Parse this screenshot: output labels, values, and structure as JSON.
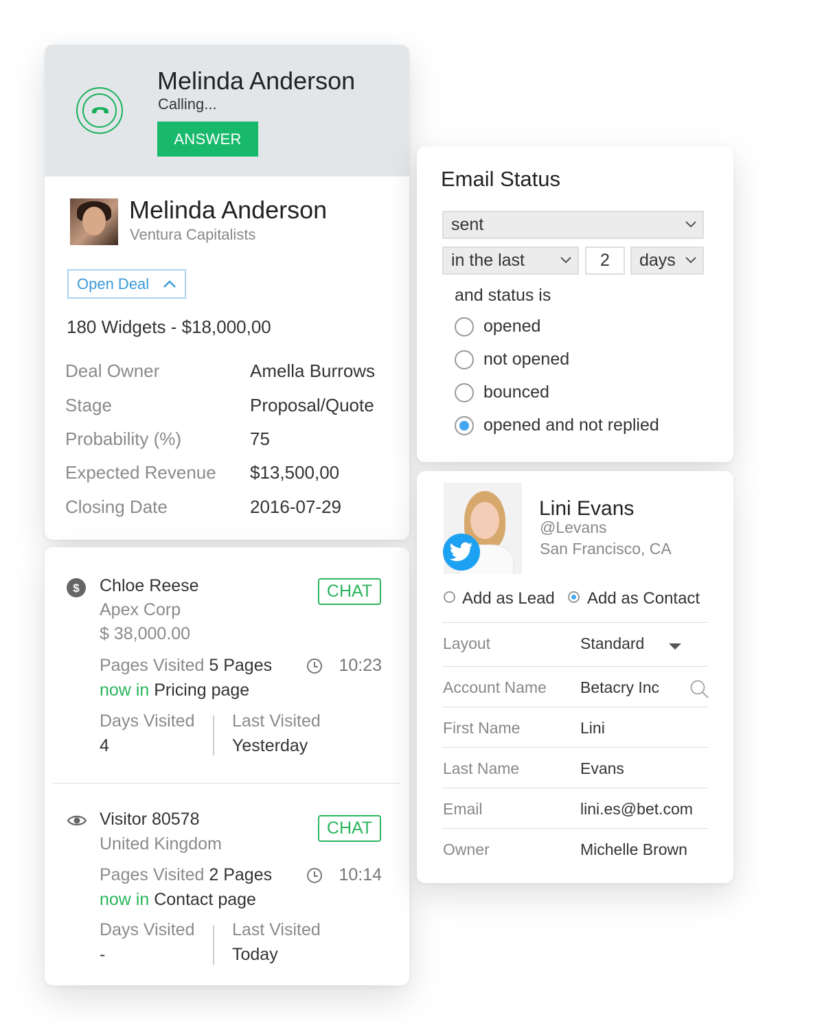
{
  "call": {
    "caller_name": "Melinda Anderson",
    "status": "Calling...",
    "answer_label": "ANSWER"
  },
  "contact": {
    "name": "Melinda Anderson",
    "company": "Ventura Capitalists",
    "open_deal_label": "Open Deal"
  },
  "deal": {
    "title": "180 Widgets - $18,000,00",
    "rows": [
      {
        "label": "Deal Owner",
        "value": "Amella Burrows"
      },
      {
        "label": "Stage",
        "value": "Proposal/Quote"
      },
      {
        "label": "Probability (%)",
        "value": "75"
      },
      {
        "label": "Expected Revenue",
        "value": "$13,500,00"
      },
      {
        "label": "Closing Date",
        "value": "2016-07-29"
      }
    ]
  },
  "visitors": [
    {
      "name": "Chloe Reese",
      "company": "Apex Corp",
      "amount": "$ 38,000.00",
      "chat_label": "CHAT",
      "pages_visited_label": "Pages Visited",
      "pages_visited_value": "5 Pages",
      "time": "10:23",
      "now_in_label": "now in",
      "now_in_page": "Pricing page",
      "days_visited_label": "Days Visited",
      "days_visited_value": "4",
      "last_visited_label": "Last Visited",
      "last_visited_value": "Yesterday"
    },
    {
      "name": "Visitor 80578",
      "company": "United Kingdom",
      "chat_label": "CHAT",
      "pages_visited_label": "Pages Visited",
      "pages_visited_value": "2 Pages",
      "time": "10:14",
      "now_in_label": "now in",
      "now_in_page": "Contact page",
      "days_visited_label": "Days Visited",
      "days_visited_value": "-",
      "last_visited_label": "Last Visited",
      "last_visited_value": "Today"
    }
  ],
  "email_status": {
    "title": "Email Status",
    "status_select": "sent",
    "period_select": "in the last",
    "period_value": "2",
    "unit_select": "days",
    "status_label": "and status is",
    "options": [
      {
        "label": "opened",
        "checked": false
      },
      {
        "label": "not opened",
        "checked": false
      },
      {
        "label": "bounced",
        "checked": false
      },
      {
        "label": "opened and not replied",
        "checked": true
      }
    ]
  },
  "lead": {
    "name": "Lini Evans",
    "handle": "@Levans",
    "location": "San Francisco, CA",
    "add_as_lead": "Add as Lead",
    "add_as_contact": "Add as Contact",
    "selected": "contact",
    "fields": [
      {
        "label": "Layout",
        "value": "Standard"
      },
      {
        "label": "Account Name",
        "value": "Betacry Inc"
      },
      {
        "label": "First Name",
        "value": "Lini"
      },
      {
        "label": "Last Name",
        "value": "Evans"
      },
      {
        "label": "Email",
        "value": "lini.es@bet.com"
      },
      {
        "label": "Owner",
        "value": "Michelle Brown"
      }
    ]
  },
  "colors": {
    "accent_green": "#18b96b",
    "link_blue": "#3a9ad9",
    "radio_blue": "#43a5f0",
    "twitter_blue": "#1da1f2"
  }
}
